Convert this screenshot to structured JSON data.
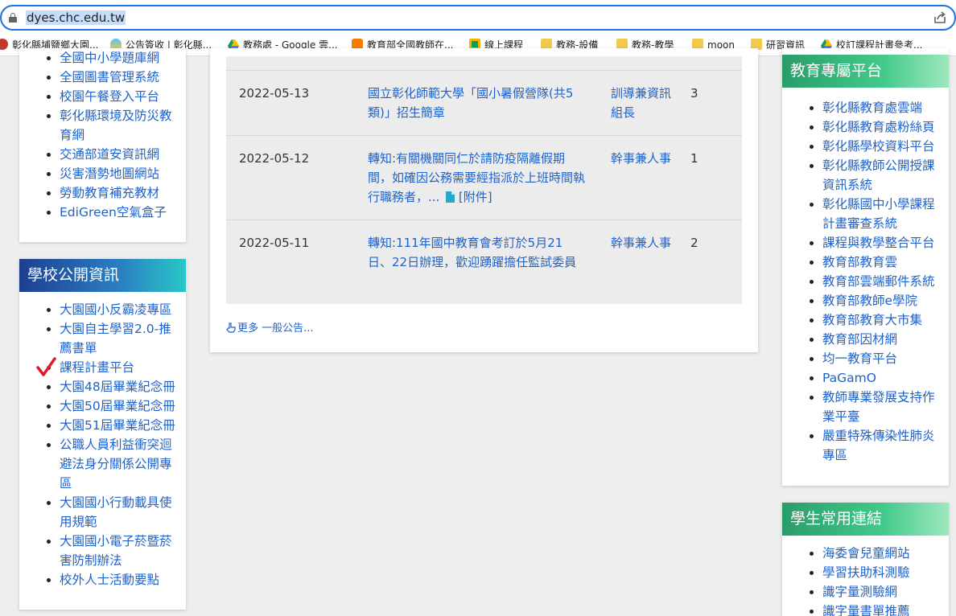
{
  "browser": {
    "url": "dyes.chc.edu.tw",
    "bookmarks": [
      {
        "label": "彰化縣埔鹽鄉大園...",
        "icon": "school-favicon"
      },
      {
        "label": "公告簽收 | 彰化縣...",
        "icon": "cloud-icon"
      },
      {
        "label": "教務處 - Google 雲...",
        "icon": "google-drive-icon"
      },
      {
        "label": "教育部全國教師在...",
        "icon": "moe-favicon"
      },
      {
        "label": "線上課程",
        "icon": "classroom-icon"
      },
      {
        "label": "教務-設備",
        "icon": "folder-icon"
      },
      {
        "label": "教務-教學",
        "icon": "folder-icon"
      },
      {
        "label": "moon",
        "icon": "folder-icon"
      },
      {
        "label": "研習資訊",
        "icon": "folder-icon"
      },
      {
        "label": "校訂課程計畫參考...",
        "icon": "google-drive-icon"
      }
    ]
  },
  "left_top_card": {
    "links": [
      "全國中小學題庫網",
      "全國圖書管理系統",
      "校園午餐登入平台",
      "彰化縣環境及防災教育網",
      "交通部道安資訊網",
      "災害潛勢地圖網站",
      "勞動教育補充教材",
      "EdiGreen空氣盒子"
    ]
  },
  "school_info": {
    "title": "學校公開資訊",
    "links": [
      "大園國小反霸凌專區",
      "大園自主學習2.0-推薦書單",
      "課程計畫平台",
      "大園48屆畢業紀念冊",
      "大園50屆畢業紀念冊",
      "大園51屆畢業紀念冊",
      "公職人員利益衝突迴避法身分關係公開專區",
      "大園國小行動載具使用規範",
      "大園國小電子菸暨菸害防制辦法",
      "校外人士活動要點"
    ]
  },
  "news": {
    "rows": [
      {
        "date": "2022-05-13",
        "title": "國立彰化師範大學「國小暑假營隊(共5類)」招生簡章",
        "unit": "訓導兼資訊組長",
        "hits": "3"
      },
      {
        "date": "2022-05-12",
        "title": "轉知:有關機關同仁於請防疫隔離假期間，如確因公務需要經指派於上班時間執行職務者，...",
        "attachment": "[附件]",
        "unit": "幹事兼人事",
        "hits": "1"
      },
      {
        "date": "2022-05-11",
        "title": "轉知:111年國中教育會考訂於5月21日、22日辦理，歡迎踴躍擔任監試委員",
        "unit": "幹事兼人事",
        "hits": "2"
      }
    ],
    "more_label": "更多 一般公告..."
  },
  "edu_platform": {
    "title": "教育專屬平台",
    "links": [
      "彰化縣教育處雲端",
      "彰化縣教育處粉絲頁",
      "彰化縣學校資料平台",
      "彰化縣教師公開授課資訊系統",
      "彰化縣國中小學課程計畫審查系統",
      "課程與教學整合平台",
      "教育部教育雲",
      "教育部雲端郵件系統",
      "教育部教師e學院",
      "教育部教育大市集",
      "教育部因材網",
      "均一教育平台",
      "PaGamO",
      "教師專業發展支持作業平臺",
      "嚴重特殊傳染性肺炎專區"
    ]
  },
  "student_links": {
    "title": "學生常用連結",
    "links": [
      "海委會兒童網站",
      "學習扶助科測驗",
      "識字量測驗網",
      "識字量書單推薦"
    ]
  },
  "colors": {
    "link": "#1f62c9",
    "address_focus": "#1a73e8",
    "check": "#e0182d"
  }
}
